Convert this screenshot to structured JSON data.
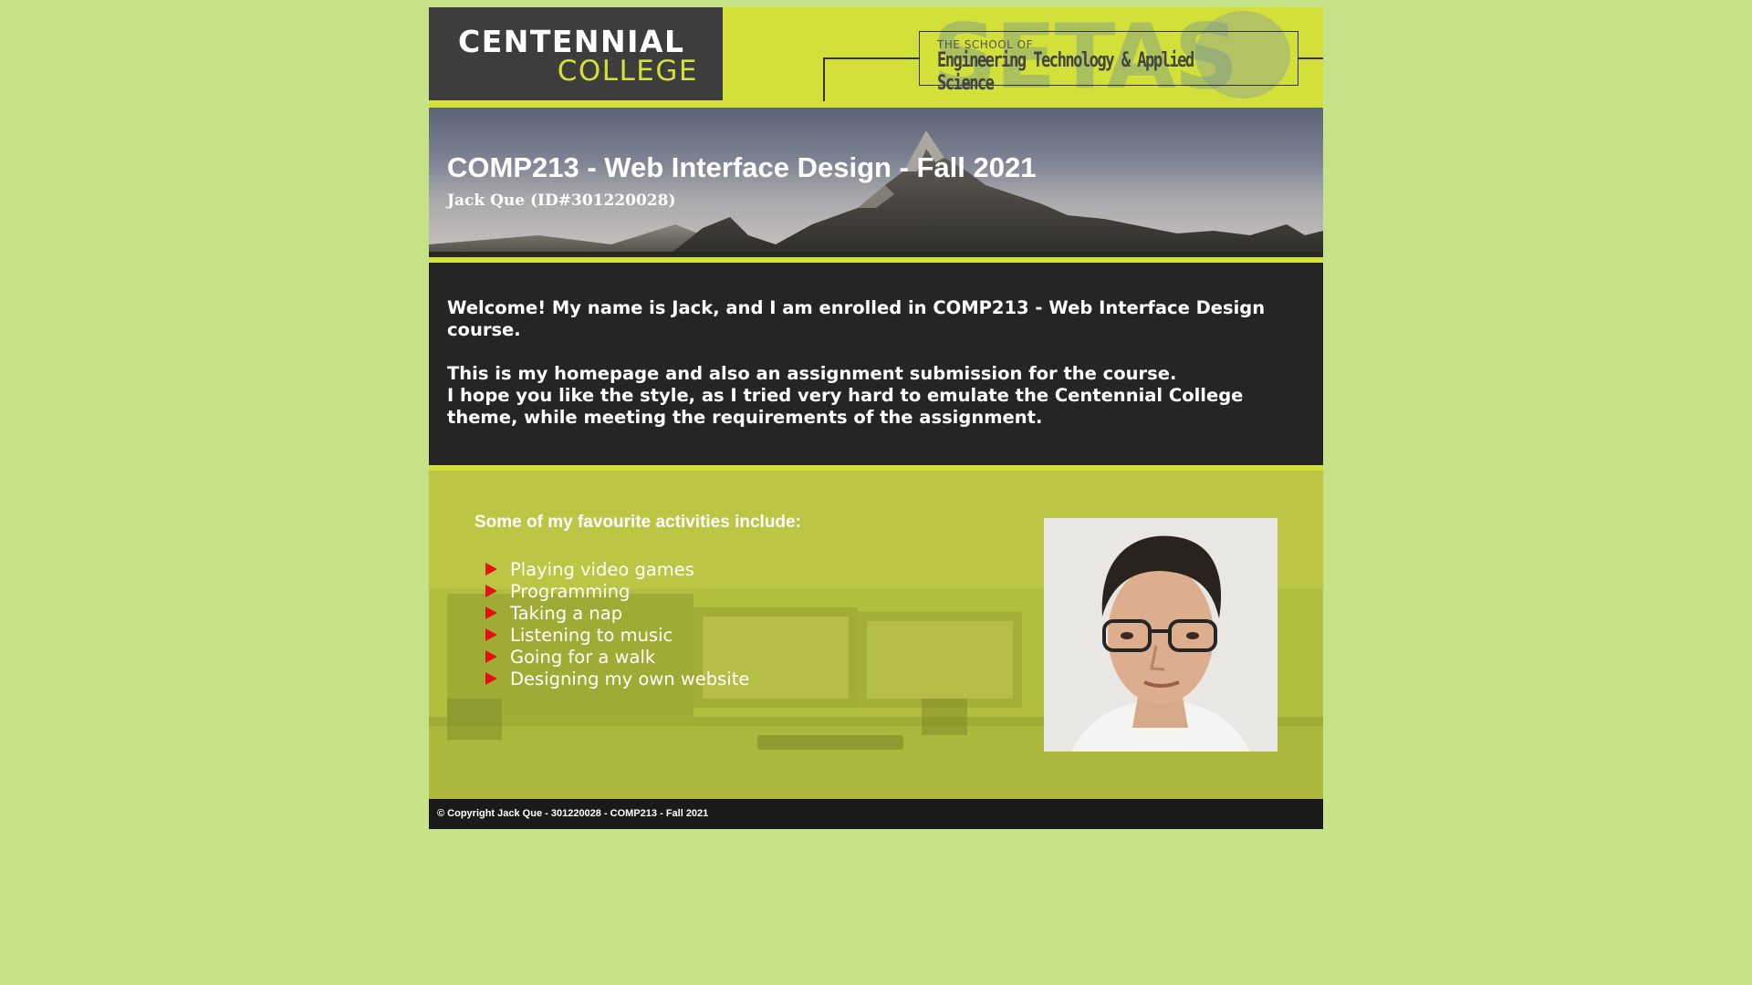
{
  "header": {
    "logo_line1": "CENTENNIAL",
    "logo_line2": "COLLEGE",
    "setas_acronym": "SETAS",
    "setas_small": "THE SCHOOL OF",
    "setas_name": "Engineering Technology & Applied Science"
  },
  "banner": {
    "title": "COMP213 - Web Interface Design - Fall 2021",
    "student": "Jack Que (ID#301220028)"
  },
  "intro": {
    "paragraph1": "Welcome! My name is Jack, and I am enrolled in COMP213 - Web Interface Design course.",
    "paragraph2_line1": "This is my homepage and also an assignment submission for the course.",
    "paragraph2_line2": "I hope you like the style, as I tried very hard to emulate the Centennial College theme, while meeting the requirements of the assignment."
  },
  "activities": {
    "heading": "Some of my favourite activities include:",
    "items": [
      "Playing video games",
      "Programming",
      "Taking a nap",
      "Listening to music",
      "Going for a walk",
      "Designing my own website"
    ]
  },
  "footer": {
    "copyright": "©  Copyright Jack Que - 301220028 - COMP213 - Fall 2021"
  },
  "colors": {
    "page_background": "#c6e289",
    "accent_lime": "#d4e03a",
    "dark_panel": "#252525",
    "bullet_red": "#e31212"
  }
}
